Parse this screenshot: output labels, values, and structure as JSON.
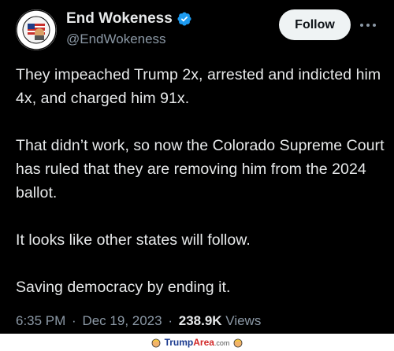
{
  "author": {
    "display_name": "End Wokeness",
    "handle": "@EndWokeness",
    "verified": true,
    "avatar_text_top": "I SUPPORT THE",
    "avatar_text_bottom": "FARMER TRIBE"
  },
  "actions": {
    "follow_label": "Follow",
    "more_icon": "ellipsis-icon"
  },
  "tweet": {
    "paragraphs": [
      "They impeached Trump 2x, arrested and indicted him 4x, and charged him 91x.",
      "That didn’t work, so now the Colorado Supreme Court has ruled that they are removing him from the 2024 ballot.",
      "It looks like other states will follow.",
      "Saving democracy by ending it."
    ],
    "time": "6:35 PM",
    "date": "Dec 19, 2023",
    "views_count": "238.9K",
    "views_label": "Views",
    "separator": "·"
  },
  "watermark": {
    "part1": "Trump",
    "part2": "Area",
    "part3": ".com"
  },
  "colors": {
    "background": "#000000",
    "text_primary": "#e7e9ea",
    "text_secondary": "#8b98a5",
    "verified_blue": "#1d9bf0",
    "follow_bg": "#eff3f4"
  }
}
